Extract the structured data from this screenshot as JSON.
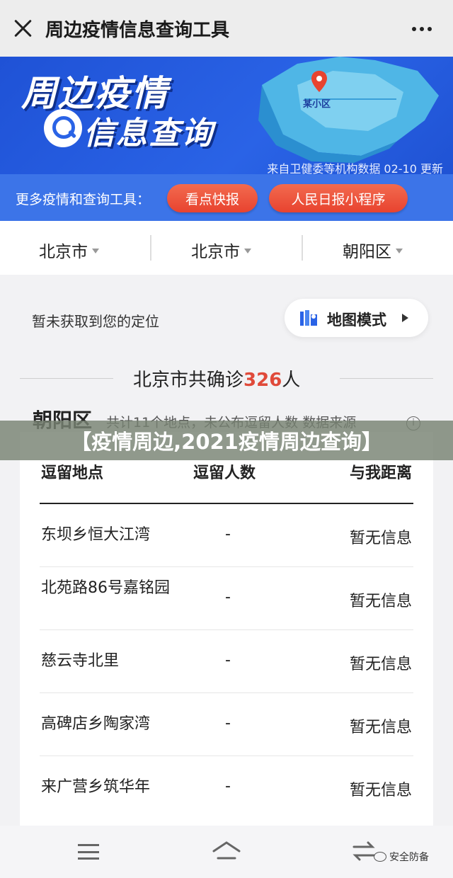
{
  "nav": {
    "title": "周边疫情信息查询工具",
    "close_icon": "close-icon",
    "more_icon": "more-dots-icon"
  },
  "banner": {
    "title_line1": "周边疫情",
    "title_line2": "信息查询",
    "map_label": "某小区",
    "source": "来自卫健委等机构数据  02-10 更新",
    "tools_label": "更多疫情和查询工具：",
    "tools": [
      "看点快报",
      "人民日报小程序"
    ],
    "colors": {
      "primary": "#2a63e6",
      "button": "#e8432f"
    }
  },
  "selectors": {
    "province": "北京市",
    "city": "北京市",
    "district": "朝阳区"
  },
  "location": {
    "status": "暂未获取到您的定位",
    "map_mode_label": "地图模式"
  },
  "summary": {
    "prefix": "北京市共确诊",
    "count": "326",
    "suffix": "人",
    "count_color": "#e04a3a"
  },
  "district": {
    "name": "朝阳区",
    "summary": "共计11个地点，未公布逗留人数  数据来源",
    "info_icon": "i"
  },
  "overlay": {
    "caption": "【疫情周边,2021疫情周边查询】"
  },
  "table": {
    "headers": [
      "逗留地点",
      "逗留人数",
      "与我距离"
    ],
    "rows": [
      {
        "place": "东坝乡恒大江湾",
        "count": "-",
        "distance": "暂无信息"
      },
      {
        "place": "北苑路86号嘉铭园",
        "count": "-",
        "distance": "暂无信息"
      },
      {
        "place": "慈云寺北里",
        "count": "-",
        "distance": "暂无信息"
      },
      {
        "place": "高碑店乡陶家湾",
        "count": "-",
        "distance": "暂无信息"
      },
      {
        "place": "来广营乡筑华年",
        "count": "-",
        "distance": "暂无信息"
      }
    ]
  },
  "watermark": {
    "text": "安全防备"
  }
}
